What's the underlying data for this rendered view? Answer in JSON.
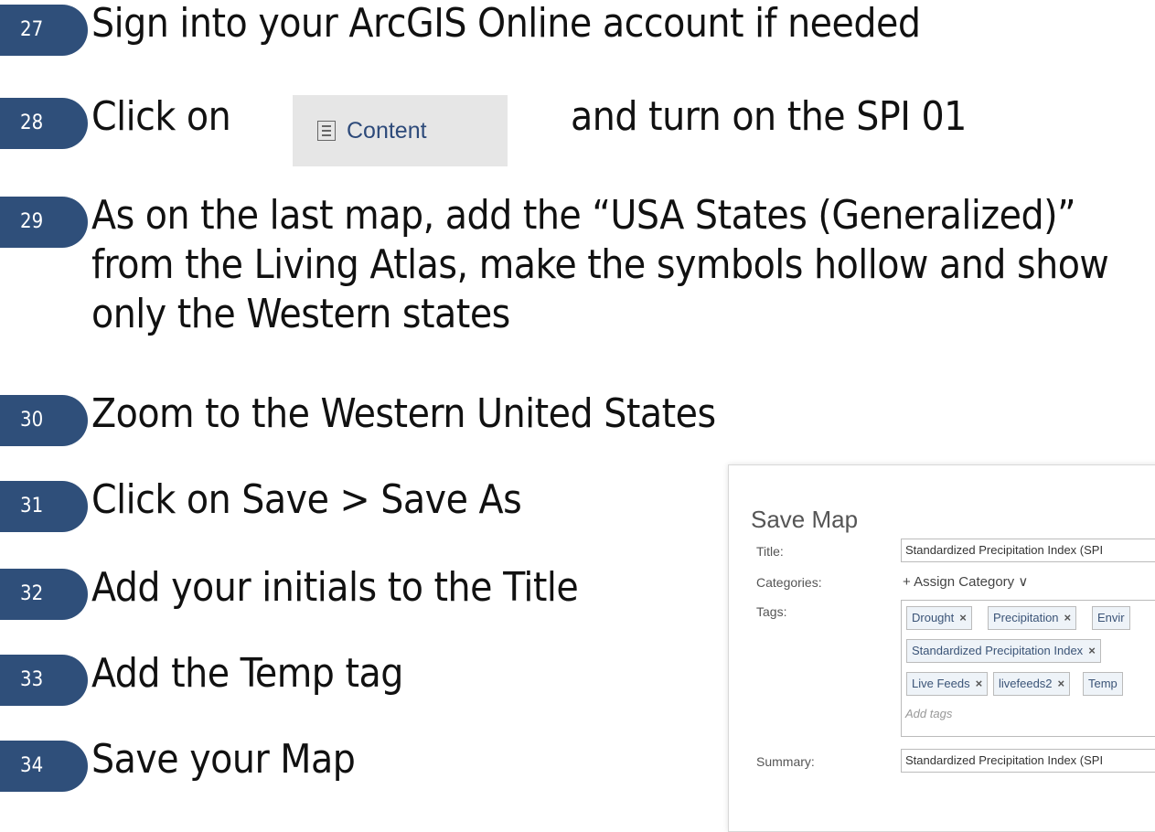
{
  "steps": [
    {
      "num": "27",
      "text": "Sign into your ArcGIS Online account if needed"
    },
    {
      "num": "28",
      "text_before": "Click on",
      "text_after": "and turn on the SPI 01",
      "chip_label": "Content",
      "chip_icon": "content-list-icon"
    },
    {
      "num": "29",
      "text": "As on the last map, add the “USA States (Generalized)” from the Living Atlas, make the symbols hollow and show only the Western states"
    },
    {
      "num": "30",
      "text": "Zoom to the Western United States"
    },
    {
      "num": "31",
      "text": "Click on Save > Save As"
    },
    {
      "num": "32",
      "text": "Add your initials to the Title"
    },
    {
      "num": "33",
      "text": "Add the Temp tag"
    },
    {
      "num": "34",
      "text": "Save your Map"
    }
  ],
  "dialog": {
    "title": "Save Map",
    "title_label": "Title:",
    "title_value": "Standardized Precipitation Index (SPI",
    "categories_label": "Categories:",
    "assign_category": "+ Assign Category ∨",
    "tags_label": "Tags:",
    "tag_rows": [
      [
        "Drought",
        "Precipitation",
        "Envir"
      ],
      [
        "Standardized Precipitation Index"
      ],
      [
        "Live Feeds",
        "livefeeds2",
        "Temp"
      ]
    ],
    "tag_remove": "×",
    "tags_placeholder": "Add tags",
    "summary_label": "Summary:",
    "summary_value": "Standardized Precipitation Index (SPI"
  },
  "colors": {
    "badge": "#2f4f7a",
    "chip": "#e6e6e6",
    "tag_bg": "#eef3f8"
  }
}
